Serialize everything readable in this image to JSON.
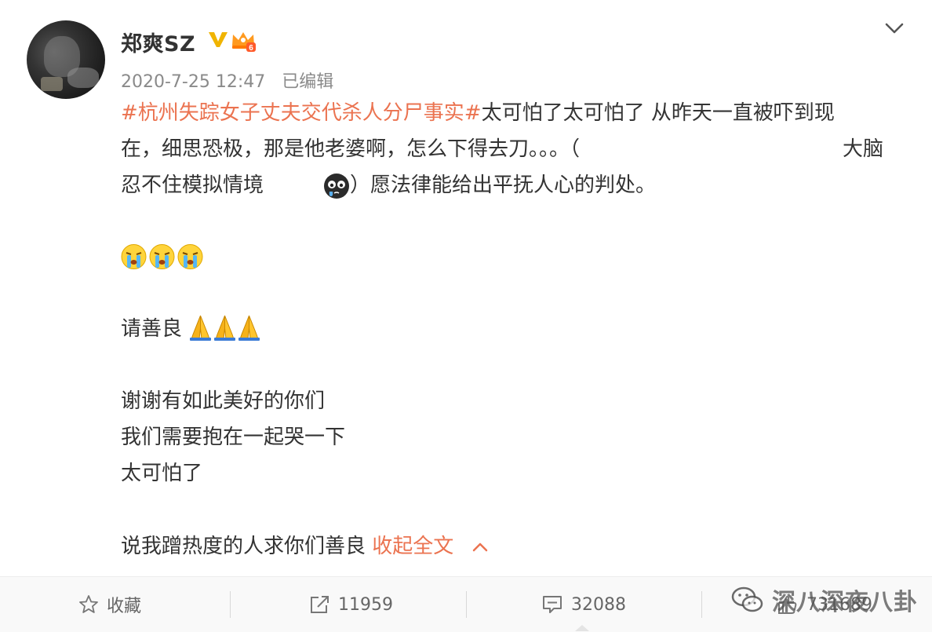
{
  "post": {
    "username": "郑爽SZ",
    "timestamp": "2020-7-25 12:47",
    "edited": "已编辑",
    "topic": "#杭州失踪女子丈夫交代杀人分尸事实#",
    "line1_rest": "太可怕了太可怕了 从昨天一直被吓到现",
    "line2_a": "在，细思恐极，那是他老婆啊，怎么下得去刀。。。（",
    "line2_b": "大脑",
    "line3_a": "忍不住模拟情境",
    "line3_b": "）愿法律能给出平抚人心的判处。",
    "line5": "请善良",
    "line6": "谢谢有如此美好的你们",
    "line7": "我们需要抱在一起哭一下",
    "line8": "太可怕了",
    "line9": "说我蹭热度的人求你们善良",
    "collapse_label": "收起全文"
  },
  "actions": {
    "favorite_label": "收藏",
    "repost_count": "11959",
    "comment_count": "32088",
    "like_count": "731689"
  },
  "watermark": {
    "text": "深八深夜八卦"
  },
  "colors": {
    "topic": "#eb7350",
    "text": "#333333",
    "meta": "#8a8a8a",
    "action_bar": "#f9f9f9"
  },
  "icons": [
    "verified-v-icon",
    "vip-crown-icon",
    "chevron-down-icon",
    "crying-emoji-icon",
    "prayer-hands-icon",
    "star-icon",
    "share-icon",
    "comment-icon",
    "like-icon",
    "wechat-icon"
  ]
}
